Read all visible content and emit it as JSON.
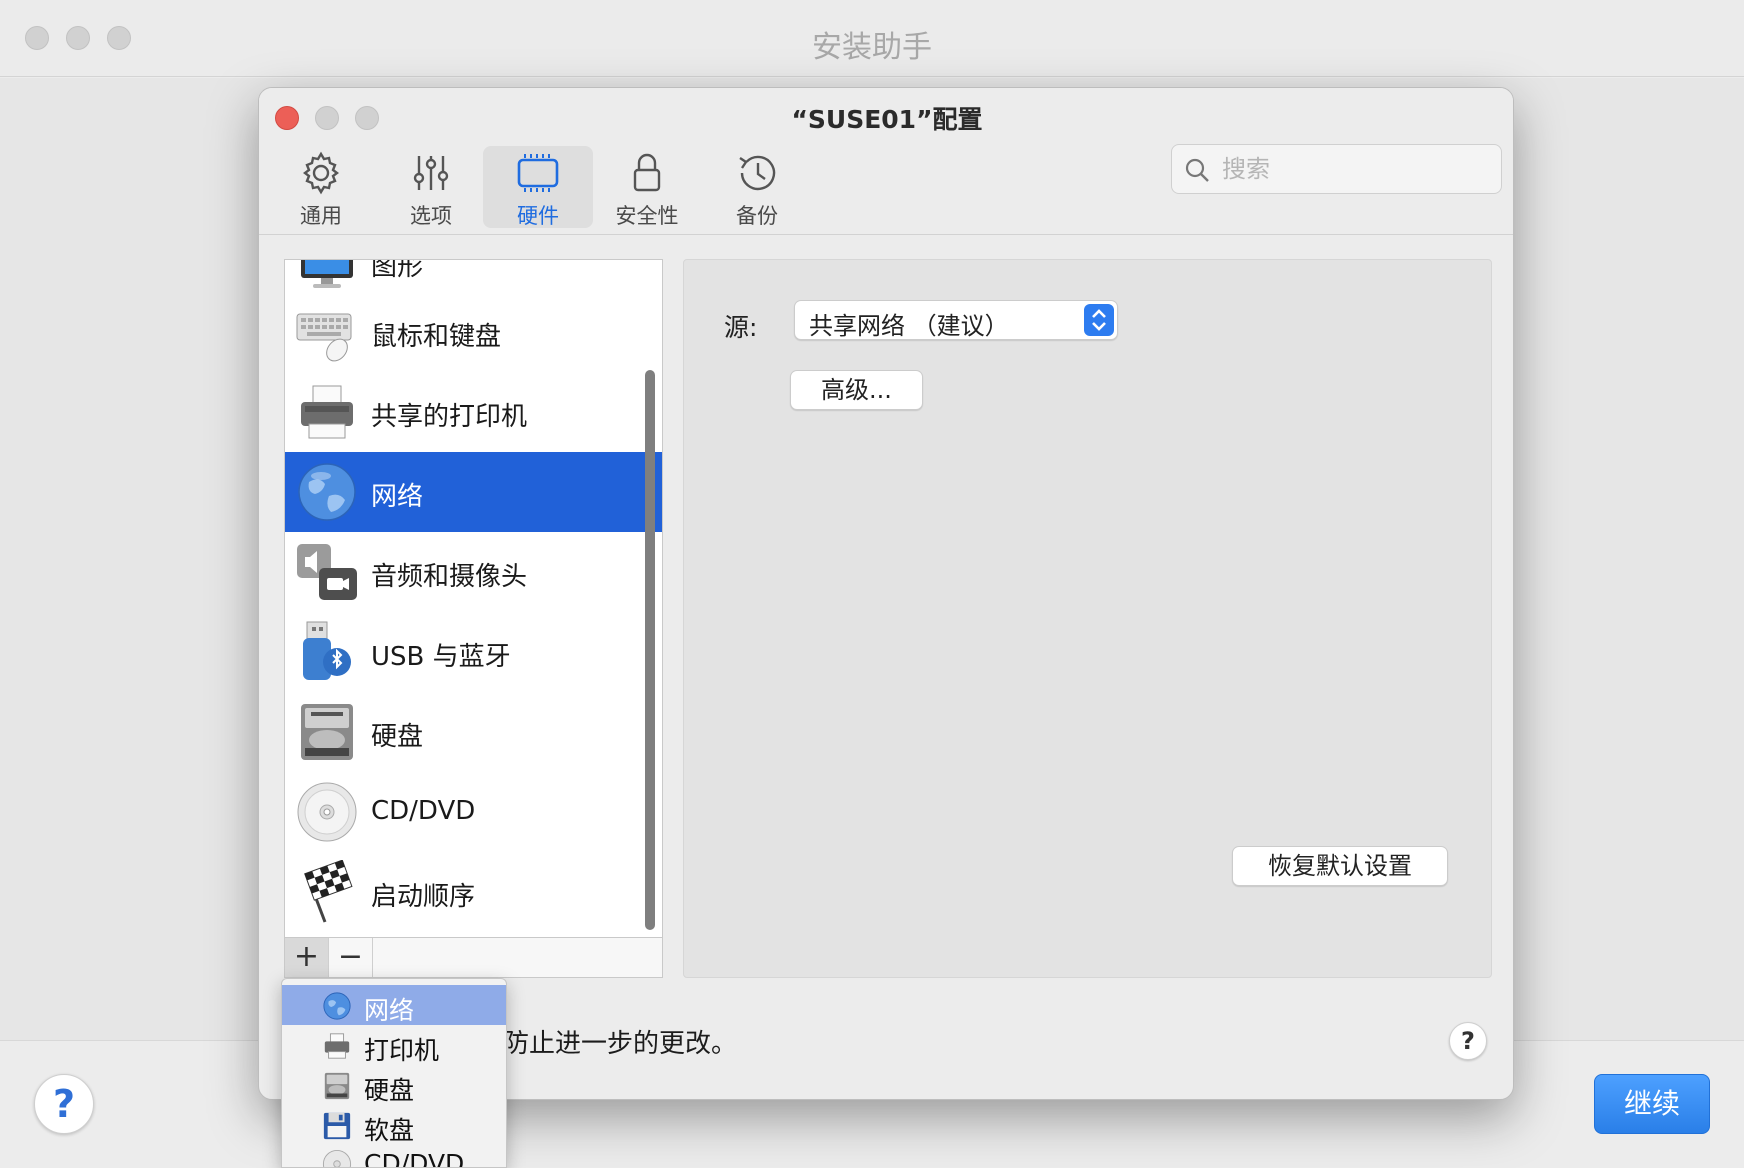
{
  "outer_window": {
    "title": "安装助手",
    "help_label": "?",
    "continue_label": "继续"
  },
  "dialog": {
    "title": "“SUSE01”配置",
    "tabs": [
      {
        "label": "通用",
        "icon": "gear-icon"
      },
      {
        "label": "选项",
        "icon": "sliders-icon"
      },
      {
        "label": "硬件",
        "icon": "hardware-icon",
        "active": true
      },
      {
        "label": "安全性",
        "icon": "lock-icon"
      },
      {
        "label": "备份",
        "icon": "history-icon"
      }
    ],
    "search_placeholder": "搜索",
    "devices": [
      {
        "label": "图形",
        "icon": "display-icon"
      },
      {
        "label": "鼠标和键盘",
        "icon": "keyboard-icon"
      },
      {
        "label": "共享的打印机",
        "icon": "printer-icon"
      },
      {
        "label": "网络",
        "icon": "network-globe-icon",
        "selected": true
      },
      {
        "label": "音频和摄像头",
        "icon": "audio-camera-icon"
      },
      {
        "label": "USB 与蓝牙",
        "icon": "usb-bluetooth-icon"
      },
      {
        "label": "硬盘",
        "icon": "hard-disk-icon"
      },
      {
        "label": "CD/DVD",
        "icon": "cd-dvd-icon"
      },
      {
        "label": "启动顺序",
        "icon": "boot-flag-icon"
      }
    ],
    "list_add": "+",
    "list_remove": "−",
    "source_label": "源:",
    "source_value": "共享网络 （建议）",
    "advanced_label": "高级...",
    "restore_label": "恢复默认设置",
    "lock_text_visible": "防止进一步的更改。",
    "help_label": "?"
  },
  "add_menu": {
    "items": [
      {
        "label": "网络",
        "icon": "network-globe-icon",
        "highlighted": true
      },
      {
        "label": "打印机",
        "icon": "printer-icon"
      },
      {
        "label": "硬盘",
        "icon": "hard-disk-icon"
      },
      {
        "label": "软盘",
        "icon": "floppy-icon"
      },
      {
        "label": "CD/DVD",
        "icon": "cd-dvd-icon"
      }
    ]
  },
  "colors": {
    "accent": "#2161d8",
    "active_tab_text": "#1f6ce0",
    "close_dot": "#ec5f57"
  }
}
